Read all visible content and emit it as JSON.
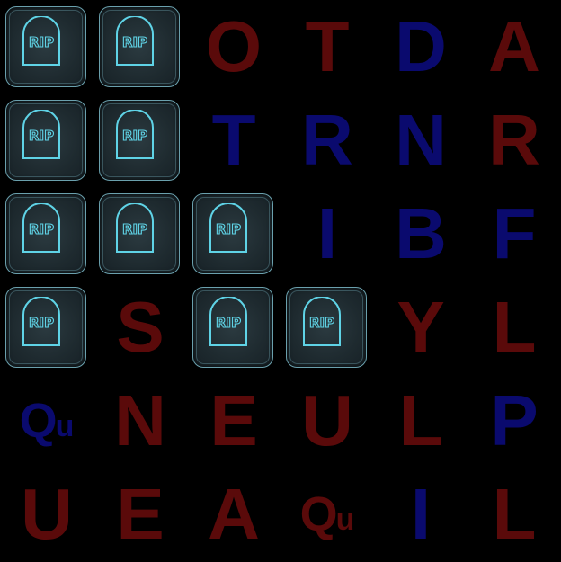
{
  "board": {
    "colors": {
      "red": "#5a0a0a",
      "blue": "#0a0a6e",
      "tile_border": "#6aa0ad",
      "tomb_glow": "#5fd3e6"
    },
    "tomb_text": "RIP",
    "rows": [
      [
        {
          "letter": "",
          "tomb": true
        },
        {
          "letter": "",
          "tomb": true
        },
        {
          "letter": "O",
          "color": "red"
        },
        {
          "letter": "T",
          "color": "red"
        },
        {
          "letter": "D",
          "color": "blue"
        },
        {
          "letter": "A",
          "color": "red"
        }
      ],
      [
        {
          "letter": "",
          "tomb": true
        },
        {
          "letter": "",
          "tomb": true
        },
        {
          "letter": "T",
          "color": "blue"
        },
        {
          "letter": "R",
          "color": "blue"
        },
        {
          "letter": "N",
          "color": "blue"
        },
        {
          "letter": "R",
          "color": "red"
        }
      ],
      [
        {
          "letter": "",
          "tomb": true
        },
        {
          "letter": "",
          "tomb": true
        },
        {
          "letter": "",
          "tomb": true
        },
        {
          "letter": "I",
          "color": "blue"
        },
        {
          "letter": "B",
          "color": "blue"
        },
        {
          "letter": "F",
          "color": "blue"
        }
      ],
      [
        {
          "letter": "",
          "tomb": true
        },
        {
          "letter": "S",
          "color": "red"
        },
        {
          "letter": "",
          "tomb": true
        },
        {
          "letter": "",
          "tomb": true
        },
        {
          "letter": "Y",
          "color": "red"
        },
        {
          "letter": "L",
          "color": "red"
        }
      ],
      [
        {
          "letter": "Qu",
          "color": "blue"
        },
        {
          "letter": "N",
          "color": "red"
        },
        {
          "letter": "E",
          "color": "red"
        },
        {
          "letter": "U",
          "color": "red"
        },
        {
          "letter": "L",
          "color": "red"
        },
        {
          "letter": "P",
          "color": "blue"
        }
      ],
      [
        {
          "letter": "U",
          "color": "red"
        },
        {
          "letter": "E",
          "color": "red"
        },
        {
          "letter": "A",
          "color": "red"
        },
        {
          "letter": "Qu",
          "color": "red"
        },
        {
          "letter": "I",
          "color": "blue"
        },
        {
          "letter": "L",
          "color": "red"
        }
      ]
    ]
  }
}
